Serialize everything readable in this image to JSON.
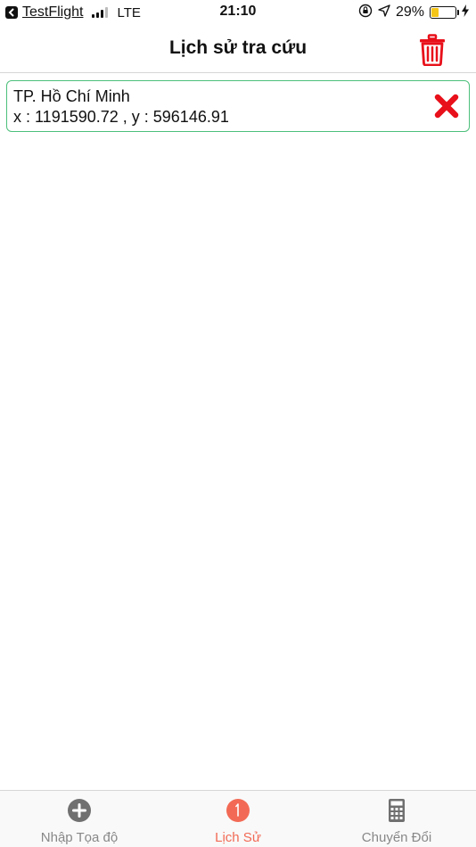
{
  "status_bar": {
    "back_app": "TestFlight",
    "network": "LTE",
    "time": "21:10",
    "battery": "29%",
    "battery_level": 0.29,
    "icons": [
      "back-arrow-icon",
      "signal-icon",
      "orientation-lock-icon",
      "location-icon",
      "battery-icon",
      "charging-bolt-icon"
    ]
  },
  "nav": {
    "title": "Lịch sử tra cứu",
    "trash_icon": "trash-icon"
  },
  "history": [
    {
      "name": "TP. Hồ Chí Minh",
      "coords": "x : 1191590.72 , y : 596146.91",
      "delete_icon": "delete-x-icon"
    }
  ],
  "tabs": [
    {
      "label": "Nhập Tọa độ",
      "icon": "plus-circle-icon",
      "active": false
    },
    {
      "label": "Lịch Sử",
      "icon": "history-clock-icon",
      "active": true
    },
    {
      "label": "Chuyển Đổi",
      "icon": "calculator-icon",
      "active": false
    }
  ],
  "colors": {
    "accent": "#f26a55",
    "danger": "#e8101a",
    "item_border": "#4cc07a",
    "inactive_tab": "#888888",
    "battery_fill": "#f5c518"
  }
}
